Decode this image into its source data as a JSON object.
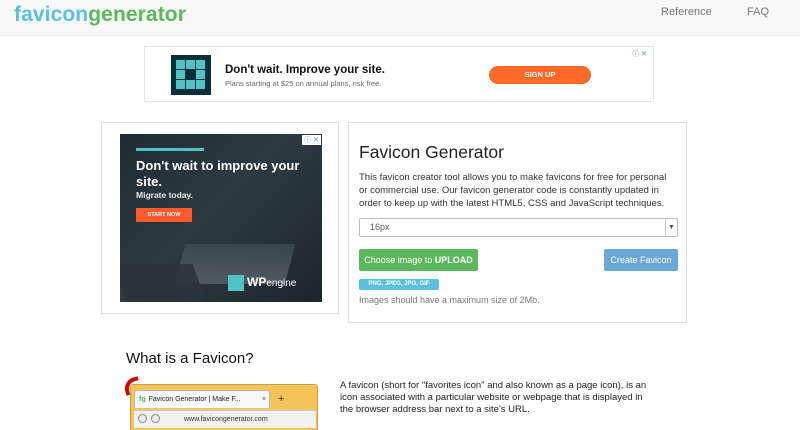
{
  "header": {
    "brand_part1": "favicon",
    "brand_part2": "generator",
    "nav": {
      "reference": "Reference",
      "faq": "FAQ"
    }
  },
  "banner_ad": {
    "title": "Don't wait. Improve your site.",
    "subtitle": "Plans starting at $25 on annual plans, risk free.",
    "cta": "SIGN UP",
    "adchoices": "ⓘ ✕"
  },
  "side_ad": {
    "headline": "Don't wait to improve your site.",
    "subline": "Migrate today.",
    "cta": "START NOW",
    "brand": "WP",
    "brand_suffix": "engine",
    "adchoices": "ⓘ ✕"
  },
  "generator": {
    "title": "Favicon Generator",
    "description": "This favicon creator tool allows you to make favicons for free for personal or commercial use. Our favicon generator code is constantly updated in order to keep up with the latest HTML5, CSS and JavaScript techniques.",
    "size_select": {
      "selected": "16px"
    },
    "upload_prefix": "Choose image to ",
    "upload_strong": "UPLOAD",
    "create_label": "Create Favicon",
    "types_badge": "PNG, JPEG, JPG, GIF",
    "size_note": "Images should have a maximum size of 2Mb."
  },
  "what_is": {
    "title": "What is a Favicon?",
    "paragraph": "A favicon (short for \"favorites icon\" and also known as a page icon), is an icon associated with a particular website or webpage that is displayed in the browser address bar next to a site's URL.",
    "browser_tab_icon": "fg",
    "browser_tab_title": "Favicon Generator | Make F...",
    "browser_tab_close": "×",
    "browser_new_tab": "+",
    "browser_url": "www.favicongenerator.com"
  },
  "colors": {
    "brand_blue": "#5bc0de",
    "brand_green": "#5cb85c",
    "create_button": "#6aa8d8",
    "signup_orange": "#ff6a2b"
  }
}
